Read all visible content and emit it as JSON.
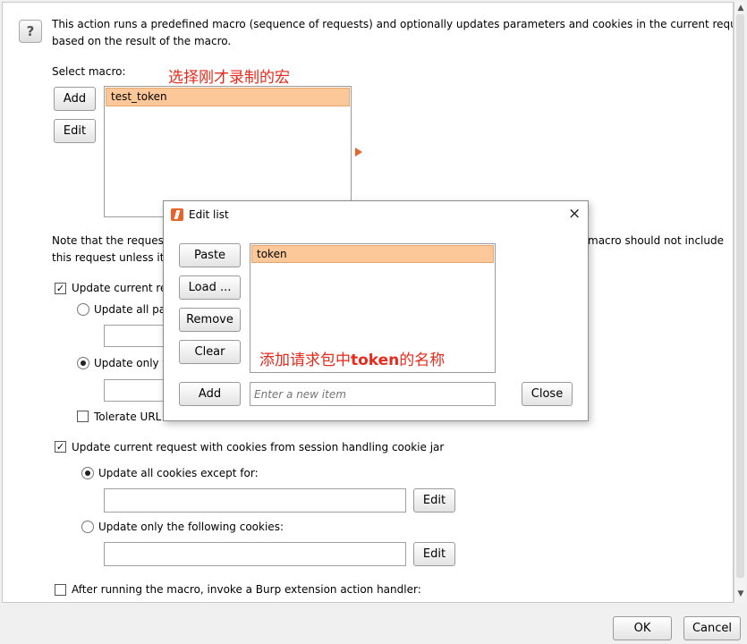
{
  "description": {
    "line1": "This action runs a predefined macro (sequence of requests) and optionally updates parameters and cookies in the current request",
    "line2": "based on the result of the macro."
  },
  "macro": {
    "label": "Select macro:",
    "add_label": "Add",
    "edit_label": "Edit",
    "items": [
      "test_token"
    ],
    "annotation": "选择刚才录制的宏"
  },
  "note": {
    "line1_left": "Note that the request",
    "line1_right": "macro should not include",
    "line2_left": "this request unless it"
  },
  "params": {
    "update_label": "Update current re",
    "update_checked": true,
    "all_label": "Update all pa",
    "only_label": "Update only t",
    "only_selected": true,
    "tolerate_label": "Tolerate URL",
    "tolerate_checked": false
  },
  "cookies": {
    "update_label": "Update current request with cookies from session handling cookie jar",
    "update_checked": true,
    "all_label": "Update all cookies except for:",
    "all_selected": true,
    "all_edit_label": "Edit",
    "only_label": "Update only the following cookies:",
    "only_selected": false,
    "only_edit_label": "Edit"
  },
  "extension": {
    "label": "After running the macro, invoke a Burp extension action handler:",
    "checked": false
  },
  "footer": {
    "ok_label": "OK",
    "cancel_label": "Cancel"
  },
  "dialog": {
    "title": "Edit list",
    "close_icon": "×",
    "paste_label": "Paste",
    "load_label": "Load ...",
    "remove_label": "Remove",
    "clear_label": "Clear",
    "add_label": "Add",
    "items": [
      "token"
    ],
    "new_item_placeholder": "Enter a new item",
    "close_label": "Close",
    "annotation_prefix": "添加请求包中",
    "annotation_bold": "token",
    "annotation_suffix": "的名称"
  },
  "colors": {
    "selection": "#fdc899",
    "annotation": "#e8291c",
    "burp_orange": "#e8622c"
  }
}
